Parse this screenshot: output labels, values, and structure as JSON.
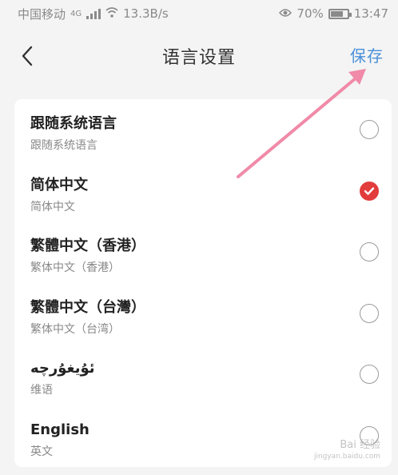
{
  "status_bar": {
    "carrier": "中国移动",
    "network": "4G",
    "speed": "13.3B/s",
    "battery": "70%",
    "time": "13:47"
  },
  "nav": {
    "title": "语言设置",
    "save_label": "保存",
    "back_icon": "chevron-left-icon"
  },
  "languages": [
    {
      "name": "跟随系统语言",
      "sub": "跟随系统语言",
      "selected": false
    },
    {
      "name": "简体中文",
      "sub": "简体中文",
      "selected": true
    },
    {
      "name": "繁體中文（香港）",
      "sub": "繁体中文（香港）",
      "selected": false
    },
    {
      "name": "繁體中文（台灣）",
      "sub": "繁体中文（台湾）",
      "selected": false
    },
    {
      "name": "ئۇيغۇرچە",
      "sub": "维语",
      "selected": false
    },
    {
      "name": "English",
      "sub": "英文",
      "selected": false
    }
  ],
  "colors": {
    "accent": "#4a90d9",
    "selected": "#e23c3c",
    "arrow": "#f08aa8"
  },
  "watermark": {
    "main": "Bai 经验",
    "sub": "jingyan.baidu.com"
  }
}
